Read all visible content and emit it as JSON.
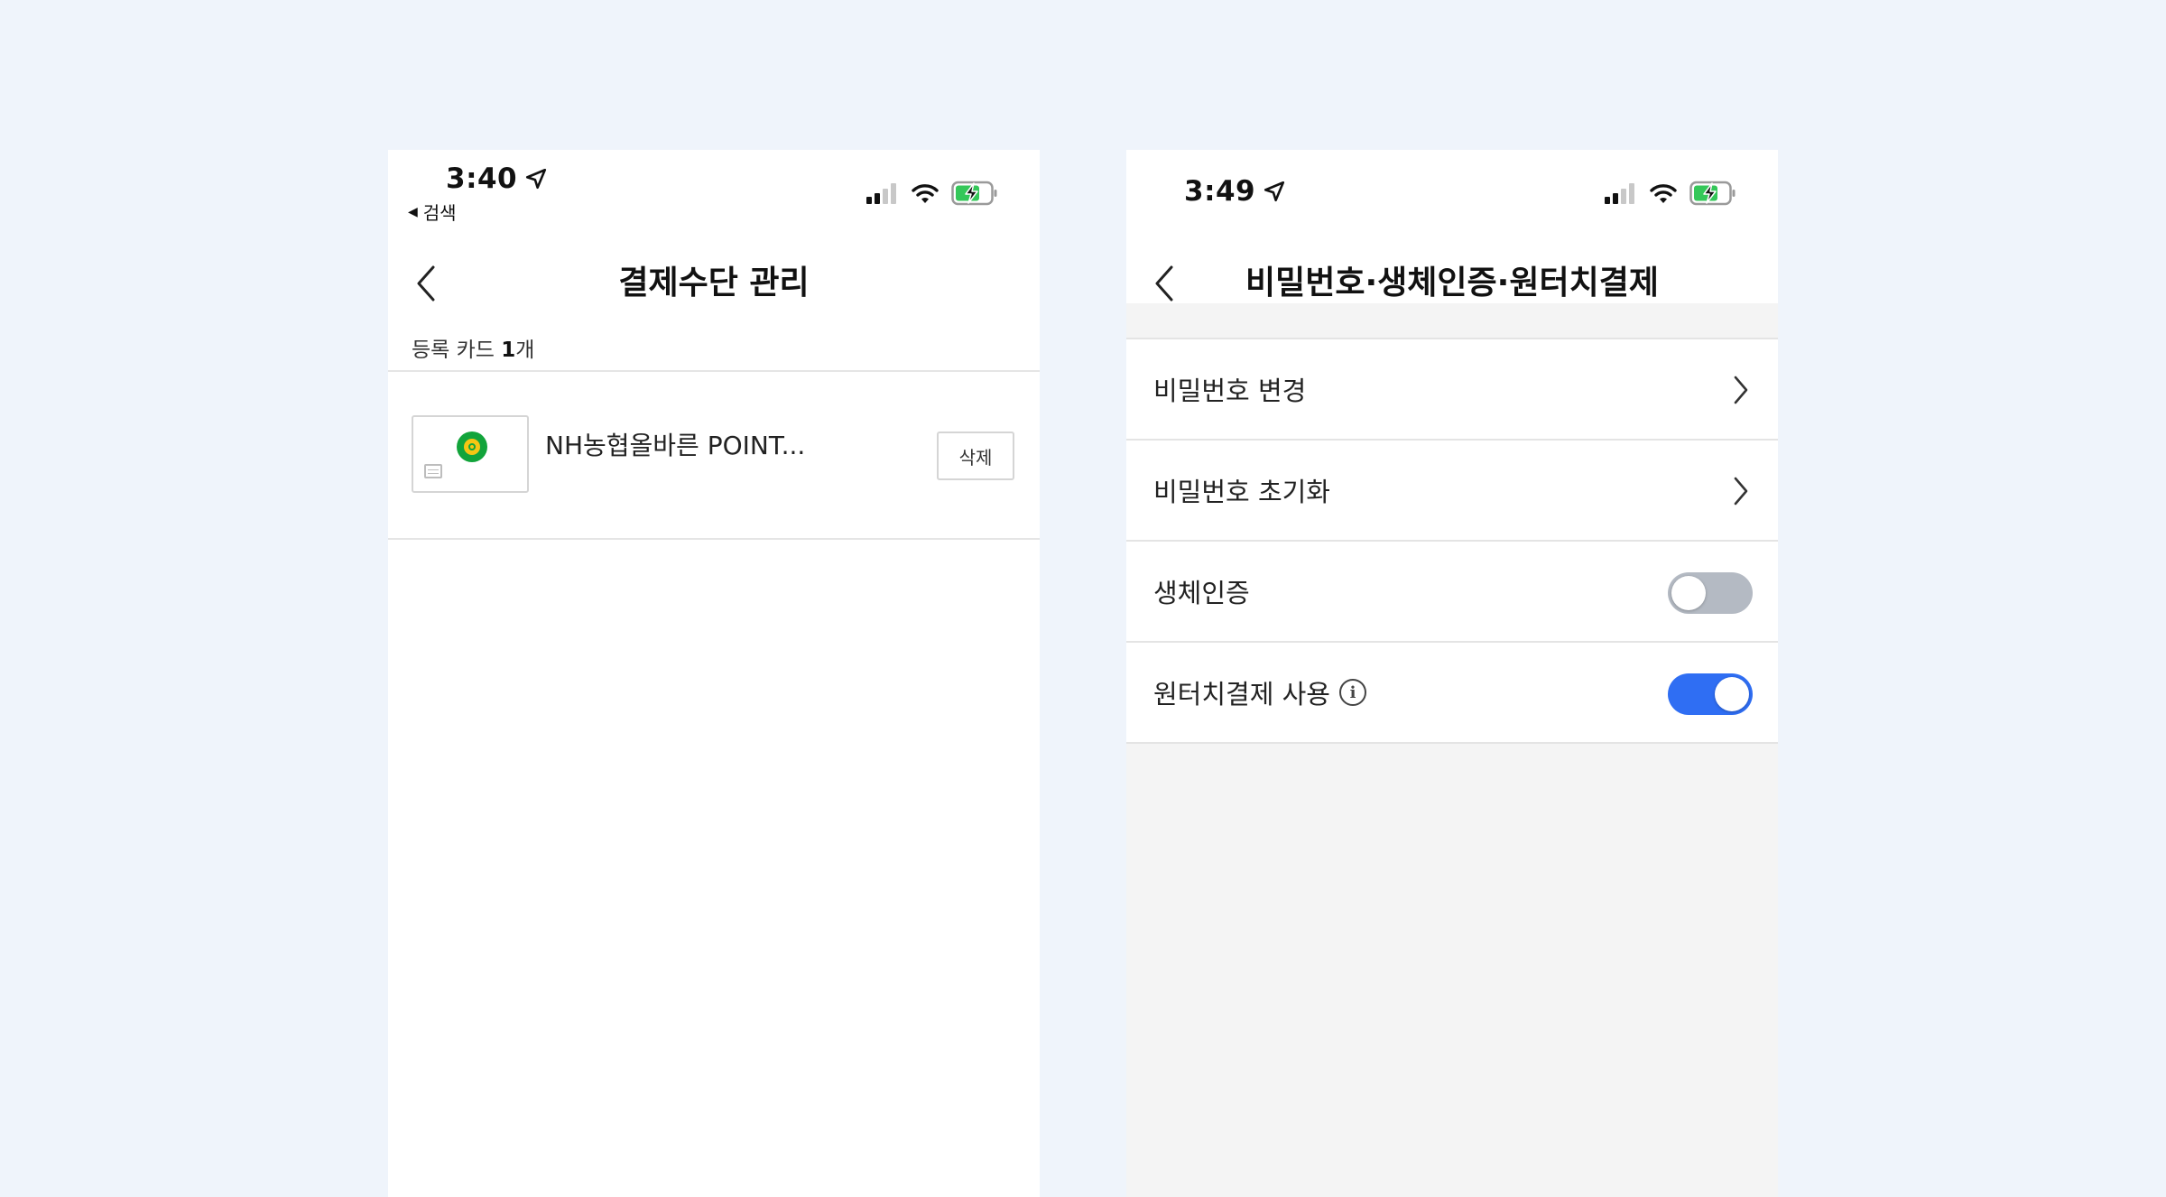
{
  "left_screen": {
    "status": {
      "time": "3:40",
      "back_app": "검색"
    },
    "title": "결제수단 관리",
    "count": {
      "prefix": "등록 카드",
      "number": "1",
      "suffix": "개"
    },
    "card": {
      "name": "NH농협올바른 POINT...",
      "delete_label": "삭제"
    }
  },
  "right_screen": {
    "status": {
      "time": "3:49"
    },
    "title": "비밀번호·생체인증·원터치결제",
    "items": [
      {
        "label": "비밀번호 변경",
        "type": "link"
      },
      {
        "label": "비밀번호 초기화",
        "type": "link"
      },
      {
        "label": "생체인증",
        "type": "toggle",
        "enabled": false
      },
      {
        "label": "원터치결제 사용",
        "type": "toggle",
        "enabled": true,
        "has_info": true
      }
    ]
  },
  "icons": {
    "location": "location-arrow-icon",
    "signal": "cellular-signal-icon",
    "wifi": "wifi-icon",
    "battery": "battery-charging-icon",
    "back": "chevron-left-icon",
    "chevron": "chevron-right-icon",
    "info": "info-icon",
    "card_brand": "nh-bank-logo-icon"
  },
  "colors": {
    "background": "#eff4fb",
    "toggle_on": "#2f6ef3",
    "toggle_off": "#b4bac3",
    "battery_green": "#34c759",
    "nh_green": "#12a43b"
  }
}
